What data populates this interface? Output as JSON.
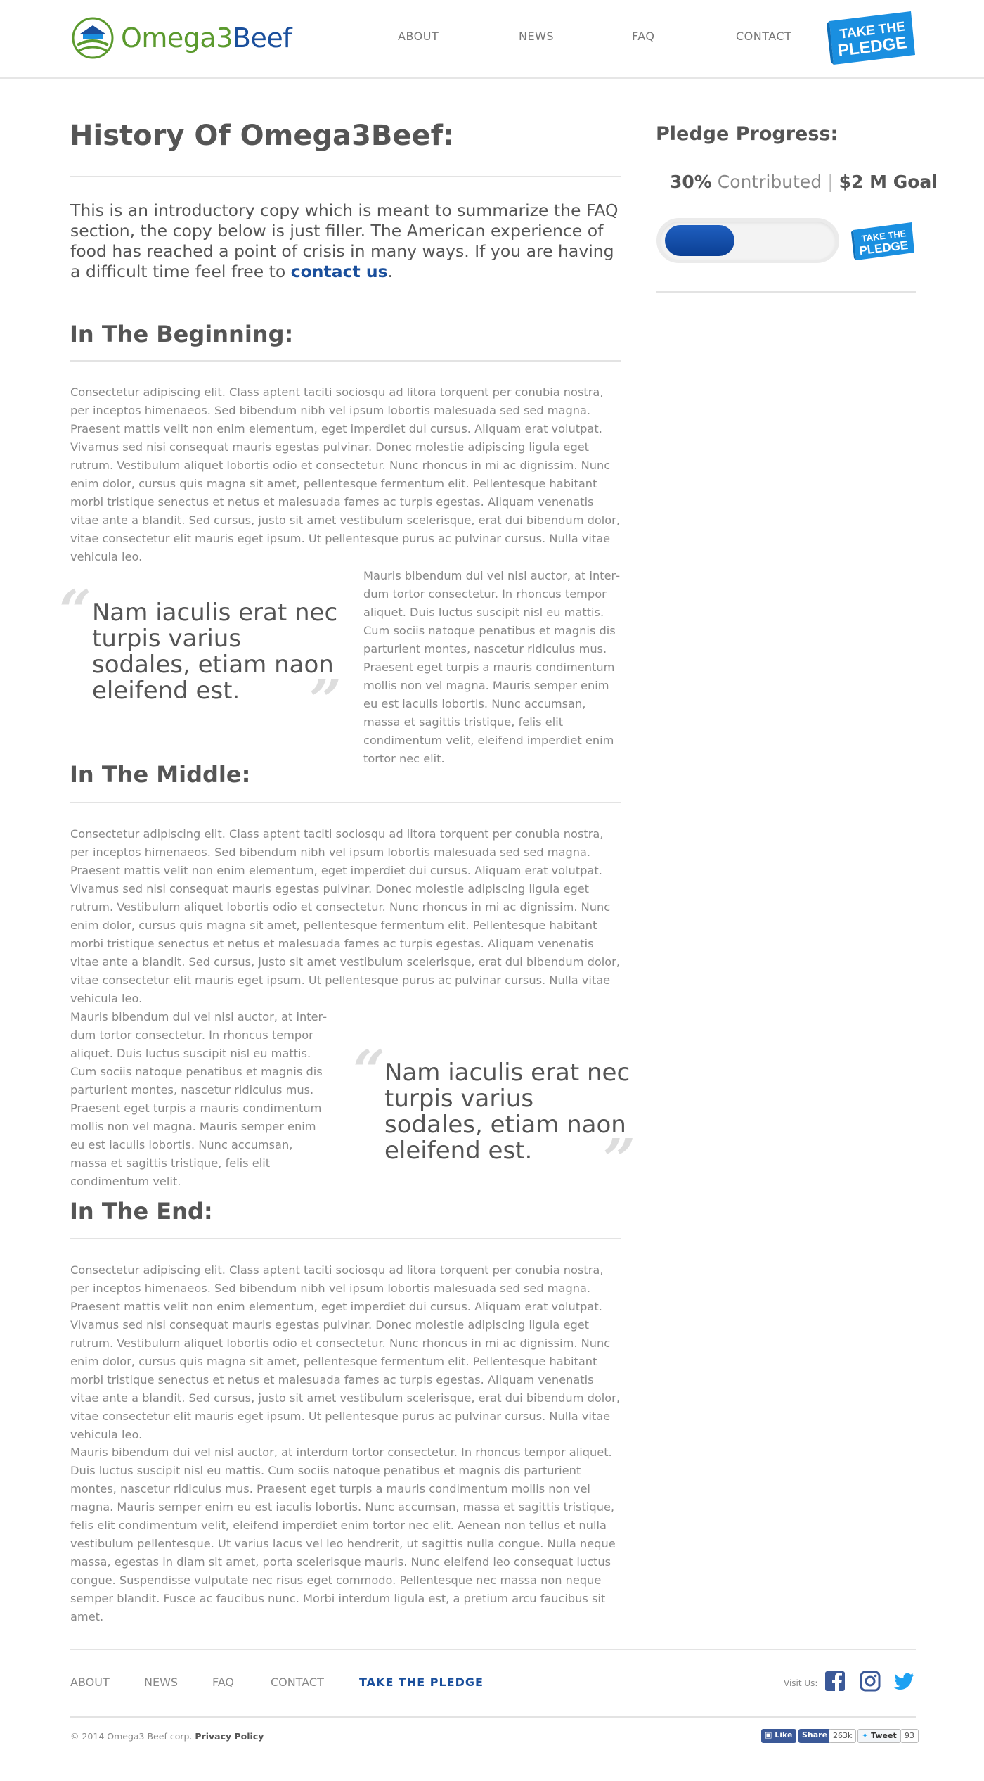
{
  "header": {
    "logo": {
      "part1": "Omega3",
      "part2": "Beef"
    },
    "nav": [
      "ABOUT",
      "NEWS",
      "FAQ",
      "CONTACT"
    ],
    "pledge_button": {
      "line1": "TAKE THE",
      "line2": "PLEDGE"
    }
  },
  "page": {
    "title": "History Of Omega3Beef:",
    "intro": "This is an introductory copy which is meant to summarize the FAQ sec­tion, the copy below is just filler. The American experience of food has reached a point of crisis in many ways. If you are having a difficult time feel free to ",
    "intro_link": "contact us",
    "intro_end": "."
  },
  "sections": [
    {
      "title": "In The Beginning:",
      "paragraph": "Consectetur adipiscing elit. Class aptent taciti sociosqu ad litora torquent per conubia nostra, per inceptos himenaeos. Sed bibendum nibh vel ipsum lobortis malesuada sed sed magna. Praesent mattis velit non enim elementum, eget imperdiet dui cursus. Aliquam erat volutpat. Vivamus sed nisi consequat mauris egestas pulvinar. Donec molestie adipiscing ligula eget rutrum. Vestibulum aliquet lobortis odio et consectetur. Nunc rhoncus in mi ac dignissim. Nunc enim dolor, cursus quis magna sit amet, pellentesque fermentum elit. Pellentesque habitant morbi tristique senectus et netus et male­suada fames ac turpis egestas. Aliquam venenatis vitae ante a blandit. Sed cursus, justo sit amet ves­tibulum scelerisque, erat dui bibendum dolor, vitae consectetur elit mauris eget ipsum. Ut pellentes­que purus ac pulvinar cursus. Nulla vitae vehicula leo.",
      "quote": "Nam iaculis erat nec turpis varius sodales, etiam naon eleifend est.",
      "side_paragraph": "Mauris bibendum dui vel nisl auctor, at inter­dum tortor consectetur. In rhoncus tempor aliquet. Duis luctus suscipit nisl eu mattis. Cum sociis natoque penatibus et magnis dis partu­rient montes, nascetur ridiculus mus. Praesent eget turpis a mauris condimentum mollis non vel magna. Mauris semper enim eu est iaculis lobortis. Nunc accumsan, massa et sagittis tris­tique, felis elit condimentum velit, eleifend imperdiet enim tortor nec elit."
    },
    {
      "title": "In The Middle:",
      "paragraph": "Consectetur adipiscing elit. Class aptent taciti sociosqu ad litora torquent per conubia nostra, per inceptos himenaeos. Sed bibendum nibh vel ipsum lobortis malesuada sed sed magna. Praesent mattis velit non enim elementum, eget imperdiet dui cursus. Aliquam erat volutpat. Vivamus sed nisi consequat mauris egestas pulvinar. Donec molestie adipiscing ligula eget rutrum. Vestibulum aliquet lobortis odio et consectetur. Nunc rhoncus in mi ac dignissim. Nunc enim dolor, cursus quis magna sit amet, pellentesque fermentum elit. Pellentesque habitant morbi tristique senectus et netus et male­suada fames ac turpis egestas. Aliquam venenatis vitae ante a blandit. Sed cursus, justo sit amet ves­tibulum scelerisque, erat dui bibendum dolor, vitae consectetur elit mauris eget ipsum. Ut pellentes­que purus ac pulvinar cursus. Nulla vitae vehicula leo.",
      "side_paragraph": "Mauris bibendum dui vel nisl auctor, at inter­dum tortor consectetur. In rhoncus tempor aliquet. Duis luctus suscipit nisl eu mattis. Cum sociis natoque penatibus et magnis dis partu­rient montes, nascetur ridiculus mus. Praesent eget turpis a mauris condimentum mollis non vel magna. Mauris semper enim eu est iaculis lobortis. Nunc accumsan, massa et sagittis tris­tique, felis elit condimentum velit.",
      "quote": "Nam iaculis erat nec turpis varius sodales, etiam naon eleifend est."
    },
    {
      "title": "In The End:",
      "paragraph": "Consectetur adipiscing elit. Class aptent taciti sociosqu ad litora torquent per conubia nostra, per inceptos himenaeos. Sed bibendum nibh vel ipsum lobortis malesuada sed sed magna. Praesent mattis velit non enim elementum, eget imperdiet dui cursus. Aliquam erat volutpat. Vivamus sed nisi consequat mauris egestas pulvinar. Donec molestie adipiscing ligula eget rutrum. Vestibulum aliquet lobortis odio et consectetur. Nunc rhoncus in mi ac dignissim. Nunc enim dolor, cursus quis magna sit amet, pellentesque fermentum elit. Pellentesque habitant morbi tristique senectus et netus et male­suada fames ac turpis egestas. Aliquam venenatis vitae ante a blandit. Sed cursus, justo sit amet ves­tibulum scelerisque, erat dui bibendum dolor, vitae consectetur elit mauris eget ipsum. Ut pellentes­que purus ac pulvinar cursus. Nulla vitae vehicula leo.",
      "paragraph2": "Mauris bibendum dui vel nisl auctor, at interdum tortor consectetur. In rhoncus tempor aliquet. Duis luctus suscipit nisl eu mattis. Cum sociis natoque penatibus et magnis dis parturient montes, nasce­tur ridiculus mus. Praesent eget turpis a mauris condimentum mollis non vel magna. Mauris semper enim eu est iaculis lobortis. Nunc accumsan, massa et sagittis tristique, felis elit condimentum velit, eleifend imperdiet enim tortor nec elit. Aenean non tellus et nulla vestibulum pellentesque. Ut varius lacus vel leo hendrerit, ut sagittis nulla congue. Nulla neque massa, egestas in diam sit amet, porta scelerisque mauris. Nunc eleifend leo consequat luctus congue. Suspendisse vulputate nec risus eget commodo. Pellentesque nec massa non neque semper blandit. Fusce ac faucibus nunc. Morbi inter­dum ligula est, a pretium arcu faucibus sit amet."
    }
  ],
  "sidebar": {
    "title": "Pledge Progress:",
    "percent": "30%",
    "contributed": "Contributed",
    "goal": "$2 M Goal",
    "progress_fraction": 0.3,
    "pledge_button": {
      "line1": "TAKE THE",
      "line2": "PLEDGE"
    }
  },
  "footer": {
    "links": [
      "ABOUT",
      "NEWS",
      "FAQ",
      "CONTACT"
    ],
    "pledge_link": "TAKE  THE  PLEDGE",
    "visit_label": "Visit Us:",
    "social_icons": [
      "facebook-icon",
      "instagram-icon",
      "twitter-icon"
    ],
    "copyright": "© 2014 Omega3 Beef corp.",
    "privacy": "Privacy Policy",
    "share": {
      "like": "Like",
      "share": "Share",
      "fb_count": "263k",
      "tweet": "Tweet",
      "tw_count": "93"
    }
  },
  "colors": {
    "brand_blue": "#1a4f9c",
    "brand_green": "#5b9a2e",
    "pledge_blue": "#1a8fe0"
  }
}
